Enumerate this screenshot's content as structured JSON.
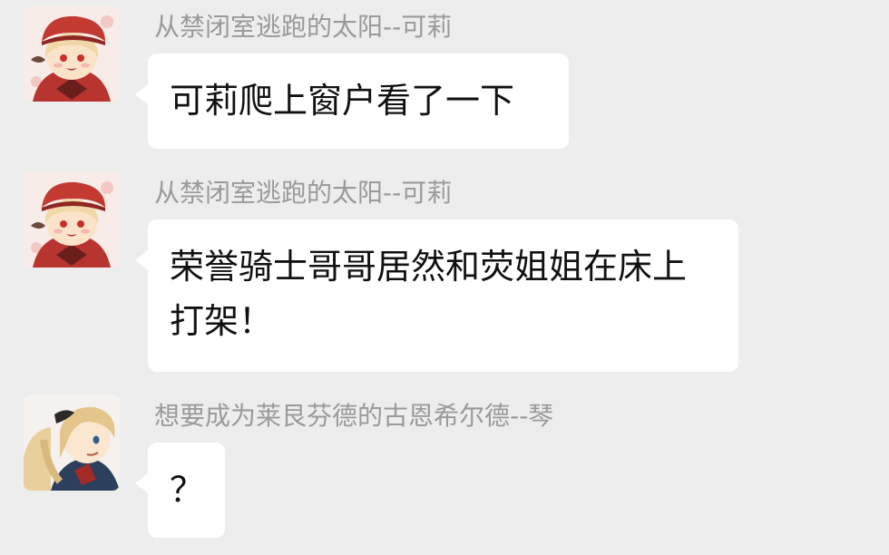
{
  "messages": [
    {
      "sender": "从禁闭室逃跑的太阳--可莉",
      "text": "可莉爬上窗户看了一下",
      "avatar": "klee-avatar"
    },
    {
      "sender": "从禁闭室逃跑的太阳--可莉",
      "text": "荣誉骑士哥哥居然和荧姐姐在床上打架！",
      "avatar": "klee-avatar"
    },
    {
      "sender": "想要成为莱艮芬德的古恩希尔德--琴",
      "text": "？",
      "avatar": "jean-avatar"
    }
  ],
  "colors": {
    "background": "#ededed",
    "bubble": "#ffffff",
    "sender_text": "#9a9a9a",
    "message_text": "#111111"
  }
}
